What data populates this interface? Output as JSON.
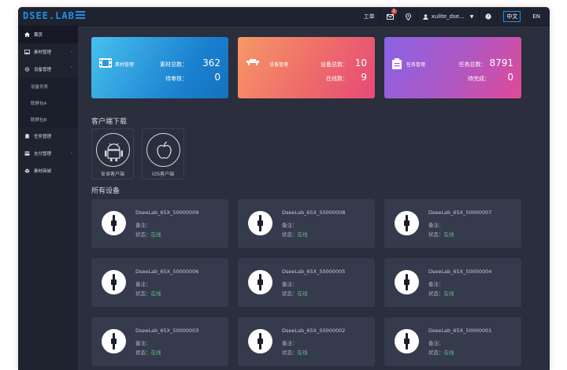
{
  "app": {
    "logo": "DSEE.LAB"
  },
  "header": {
    "ticket": "工单",
    "mail_badge": "1",
    "user": "xulite_dse...",
    "lang_zh": "中文",
    "lang_en": "EN"
  },
  "sidebar": {
    "items": [
      {
        "label": "首页"
      },
      {
        "label": "素材管理"
      },
      {
        "label": "设备管理"
      },
      {
        "label": "设备列表"
      },
      {
        "label": "联屏包A"
      },
      {
        "label": "联屏包B"
      },
      {
        "label": "任务管理"
      },
      {
        "label": "支付管理"
      },
      {
        "label": "素材商城"
      }
    ]
  },
  "stats": [
    {
      "title": "素材管理",
      "row1_label": "素材总数：",
      "row1_value": "362",
      "row2_label": "待审核：",
      "row2_value": "0",
      "gradient": [
        "#3fb6e8",
        "#1478c8"
      ]
    },
    {
      "title": "设备管理",
      "row1_label": "设备总数：",
      "row1_value": "10",
      "row2_label": "在线数：",
      "row2_value": "9",
      "gradient": [
        "#f58a63",
        "#e8466e"
      ]
    },
    {
      "title": "任务管理",
      "row1_label": "任务总数：",
      "row1_value": "8791",
      "row2_label": "待完成：",
      "row2_value": "0",
      "gradient": [
        "#8d62e6",
        "#d94aa0"
      ]
    }
  ],
  "client_download": {
    "title": "客户端下载",
    "android": "安卓客户端",
    "ios": "iOS客户端"
  },
  "devices": {
    "title": "所有设备",
    "note_label": "备注：",
    "status_label": "状态：",
    "items": [
      {
        "name": "DseeLab_65X_50000009",
        "status": "在线"
      },
      {
        "name": "DseeLab_65X_50000008",
        "status": "在线"
      },
      {
        "name": "DseeLab_65X_50000007",
        "status": "在线"
      },
      {
        "name": "DseeLab_65X_50000006",
        "status": "在线"
      },
      {
        "name": "DseeLab_65X_50000005",
        "status": "在线"
      },
      {
        "name": "DseeLab_65X_50000004",
        "status": "在线"
      },
      {
        "name": "DseeLab_65X_50000003",
        "status": "在线"
      },
      {
        "name": "DseeLab_65X_50000002",
        "status": "在线"
      },
      {
        "name": "DseeLab_65X_50000001",
        "status": "在线"
      }
    ]
  },
  "colors": {
    "accent": "#1e90e6",
    "online": "#5fc07a",
    "sidebar_bg": "#1f2330",
    "content_bg": "#2a2e3d"
  }
}
